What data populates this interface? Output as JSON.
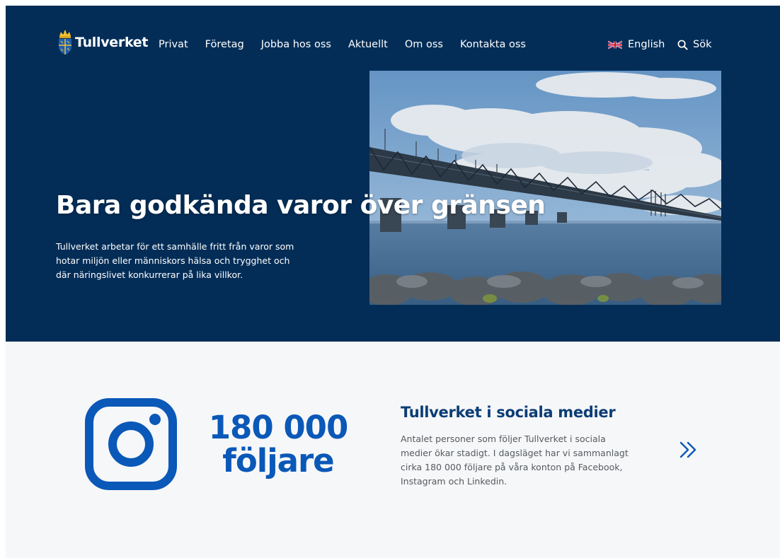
{
  "header": {
    "logo_text": "Tullverket",
    "nav": [
      {
        "label": "Privat"
      },
      {
        "label": "Företag"
      },
      {
        "label": "Jobba hos oss"
      },
      {
        "label": "Aktuellt"
      },
      {
        "label": "Om oss"
      },
      {
        "label": "Kontakta oss"
      }
    ],
    "language_label": "English",
    "search_label": "Sök"
  },
  "hero": {
    "title": "Bara godkända varor över gränsen",
    "text": "Tullverket arbetar för ett samhälle fritt från varor som hotar miljön eller människors hälsa och trygghet och där näringslivet konkurrerar på lika villkor."
  },
  "social": {
    "followers_number": "180 000",
    "followers_word": "följare",
    "title": "Tullverket i sociala medier",
    "text": "Antalet personer som följer Tullverket i sociala medier ökar stadigt. I dagsläget har vi sammanlagt cirka 180 000 följare på våra konton på Facebook, Instagram och Linkedin."
  },
  "icons": [
    "crest-logo-icon",
    "uk-flag-icon",
    "search-icon",
    "instagram-icon",
    "double-chevron-right-icon"
  ],
  "colors": {
    "hero_background": "#032d57",
    "section_background": "#f6f7f8",
    "accent_blue": "#0a58b8",
    "heading_blue": "#0b3d76"
  }
}
